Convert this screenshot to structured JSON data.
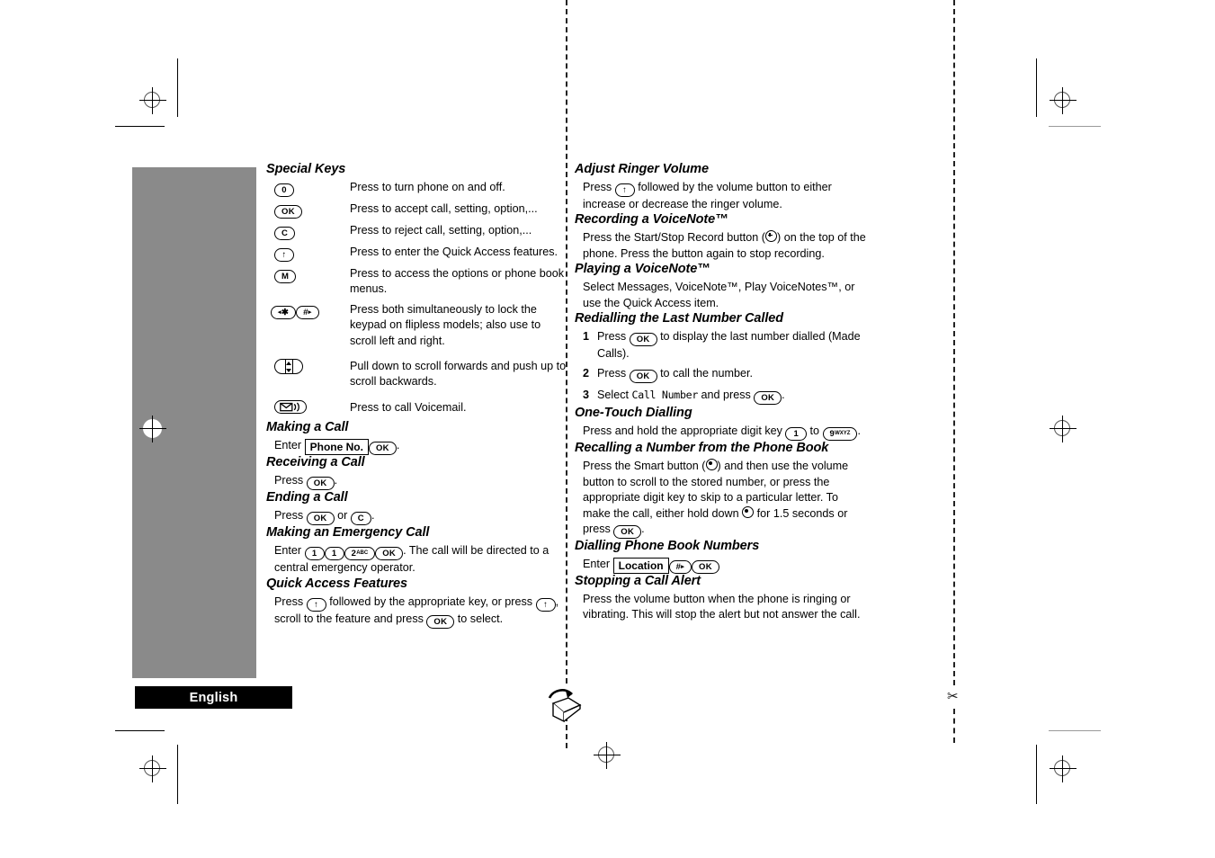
{
  "page": {
    "language_tab": "English",
    "colors": {
      "panel_gray": "#8a8a8a",
      "tab_black": "#000000"
    }
  },
  "left_column": {
    "special_keys": {
      "heading": "Special Keys",
      "rows": [
        {
          "key": "power-key",
          "key_label": "0",
          "desc": "Press to turn phone on and off."
        },
        {
          "key": "ok-key",
          "key_label": "OK",
          "desc": "Press to accept call, setting, option,..."
        },
        {
          "key": "clear-key",
          "key_label": "C",
          "desc": "Press to reject call, setting, option,..."
        },
        {
          "key": "up-arrow-key",
          "key_label": "↑",
          "desc": "Press to enter the Quick Access features."
        },
        {
          "key": "menu-key",
          "key_label": "M",
          "desc": "Press to access the options or phone book menus."
        },
        {
          "key": "star-hash-keys",
          "key_label": "◂✱  #▸",
          "desc": "Press both simultaneously to lock the keypad on flipless models; also use to scroll left and right."
        },
        {
          "key": "scroll-key",
          "key_label": "scroll",
          "desc": "Pull down to scroll forwards and push up to scroll backwards."
        },
        {
          "key": "voicemail-key",
          "key_label": "voicemail",
          "desc": "Press to call Voicemail."
        }
      ]
    },
    "making_a_call": {
      "heading": "Making a Call",
      "prefix": "Enter",
      "field": "Phone No.",
      "key": "OK",
      "suffix": "."
    },
    "receiving_a_call": {
      "heading": "Receiving a Call",
      "prefix": "Press",
      "key": "OK",
      "suffix": "."
    },
    "ending_a_call": {
      "heading": "Ending a Call",
      "prefix": "Press",
      "key1": "OK",
      "middle": "or",
      "key2": "C",
      "suffix": "."
    },
    "emergency_call": {
      "heading": "Making an Emergency Call",
      "prefix": "Enter",
      "key1": "1",
      "key2": "1",
      "key3": "2",
      "key3_sup": "ABC",
      "key4": "OK",
      "suffix": ". The call will be directed to a central emergency operator."
    },
    "quick_access": {
      "heading": "Quick Access Features",
      "part1": "Press",
      "key1": "↑",
      "part2": "followed by the appropriate key, or press",
      "key2": "↑",
      "part3": ", scroll to the feature and press",
      "key3": "OK",
      "part4": "to select."
    }
  },
  "right_column": {
    "adjust_ringer_volume": {
      "heading": "Adjust Ringer Volume",
      "part1": "Press",
      "key1": "↑",
      "part2": "followed by the volume button to either increase or decrease the ringer volume."
    },
    "recording_voicenote": {
      "heading": "Recording a VoiceNote™",
      "part1": "Press the Start/Stop Record button (",
      "part2": ") on the top of the phone. Press the button again to stop recording."
    },
    "playing_voicenote": {
      "heading": "Playing a VoiceNote™",
      "body": "Select Messages, VoiceNote™, Play VoiceNotes™, or use the Quick Access item."
    },
    "redialling": {
      "heading": "Redialling the Last Number Called",
      "steps": [
        {
          "n": "1",
          "pre": "Press",
          "key": "OK",
          "post": "to display the last number dialled (Made Calls)."
        },
        {
          "n": "2",
          "pre": "Press",
          "key": "OK",
          "post": "to call the number."
        },
        {
          "n": "3",
          "pre": "Select",
          "mono": "Call Number",
          "mid": "and press",
          "key": "OK",
          "post": "."
        }
      ]
    },
    "one_touch_dialling": {
      "heading": "One-Touch Dialling",
      "part1": "Press and hold the appropriate digit key",
      "key1": "1",
      "part2": "to",
      "key2": "9",
      "key2_sup": "WXYZ",
      "part3": "."
    },
    "recalling_number": {
      "heading": "Recalling a Number from the Phone Book",
      "part1": "Press the Smart button (",
      "part2": ") and then use the volume button to scroll to the stored number, or press the appropriate digit key to skip to a particular letter. To make the call, either hold down",
      "part3": "for 1.5 seconds or press",
      "key": "OK",
      "part4": "."
    },
    "dialling_phone_book": {
      "heading": "Dialling Phone Book Numbers",
      "prefix": "Enter",
      "field": "Location",
      "key1": "#▸",
      "key2": "OK"
    },
    "stopping_call_alert": {
      "heading": "Stopping a Call Alert",
      "body": "Press the volume button when the phone is ringing or vibrating. This will stop the alert but not answer the call."
    }
  }
}
